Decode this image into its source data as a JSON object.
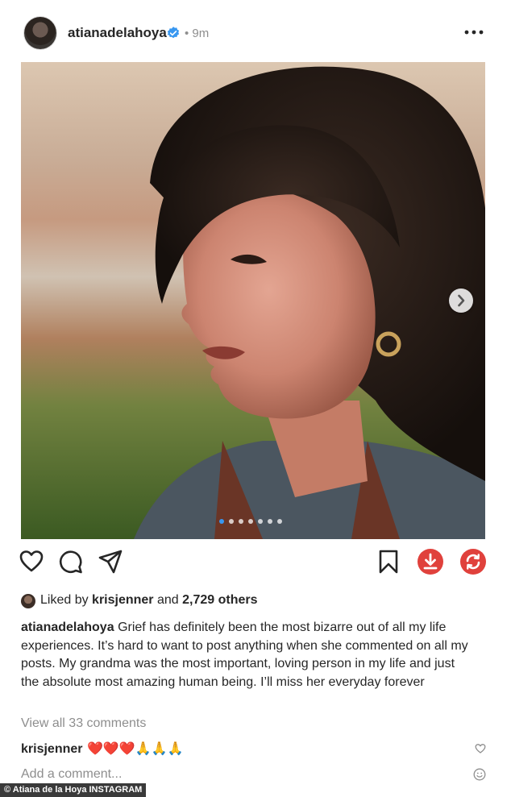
{
  "post": {
    "username": "atianadelahoya",
    "time": "• 9m"
  },
  "icons": {
    "verified": "verified-badge-icon",
    "more": "more-options-icon",
    "like": "heart-icon",
    "comment": "comment-icon",
    "share": "share-icon",
    "save": "bookmark-icon",
    "download": "download-icon",
    "repost": "repost-icon",
    "next": "chevron-right-icon",
    "emoji": "emoji-icon"
  },
  "carousel": {
    "current_index": 1,
    "total": 7
  },
  "likes": {
    "prefix": "Liked by",
    "user": "krisjenner",
    "middle": "and",
    "others": "2,729 others"
  },
  "caption": {
    "user": "atianadelahoya",
    "text": "Grief has definitely been the most bizarre out of all my life experiences. It’s hard to want to post anything when she commented on all my posts. My grandma was the most important, loving person in my life and just the absolute most amazing human being. I’ll miss her everyday forever"
  },
  "view_all_comments": "View all 33 comments",
  "comment": {
    "user": "krisjenner",
    "text": "❤️❤️❤️🙏🙏🙏"
  },
  "add_comment_placeholder": "Add a comment...",
  "credit": "© Atiana de la Hoya INSTAGRAM",
  "colors": {
    "verified_blue": "#3897f0",
    "download_red": "#e0413c",
    "repost_red": "#e0413c",
    "muted_text": "#8e8e8e"
  }
}
